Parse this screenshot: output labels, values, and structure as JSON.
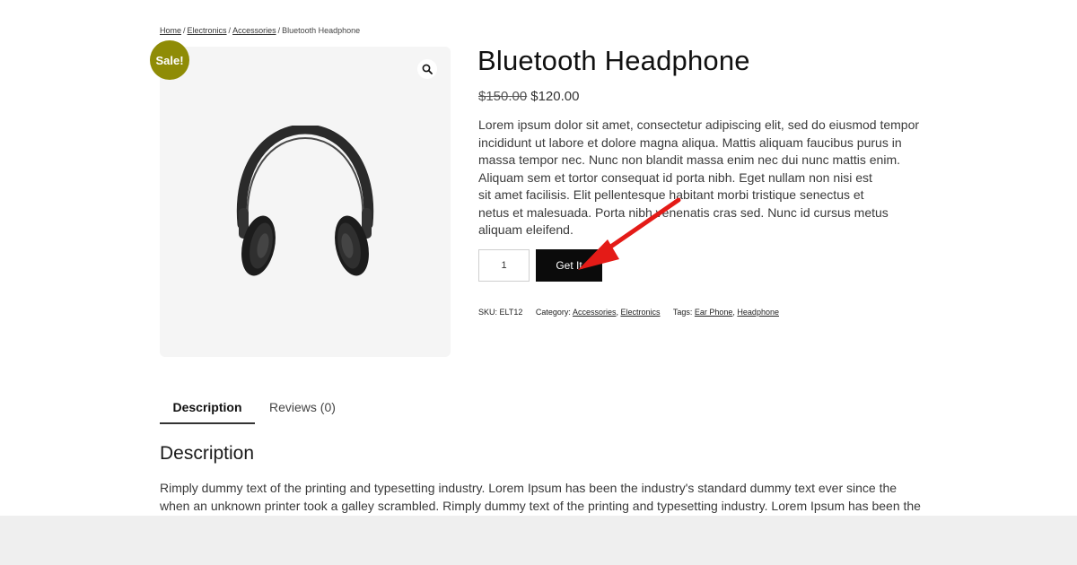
{
  "breadcrumb": {
    "items": [
      "Home",
      "Electronics",
      "Accessories"
    ],
    "separator": "/",
    "current": "Bluetooth Headphone"
  },
  "product": {
    "sale_badge": "Sale!",
    "title": "Bluetooth Headphone",
    "price_old": "$150.00",
    "price_new": "$120.00",
    "short_description_lines": [
      "Lorem ipsum dolor sit amet, consectetur adipiscing elit, sed do eiusmod tempor",
      "incididunt ut labore et dolore magna aliqua. Mattis aliquam faucibus purus in",
      "massa tempor nec. Nunc non blandit massa enim nec dui nunc mattis enim.",
      "Aliquam sem et tortor consequat id porta nibh. Eget nullam non nisi est",
      "sit amet facilisis. Elit pellentesque habitant morbi tristique senectus et",
      "netus et malesuada. Porta nibh venenatis cras sed. Nunc id cursus metus",
      "aliquam eleifend."
    ],
    "quantity": "1",
    "cta_label": "Get It",
    "image_icon": "headphones-image",
    "zoom_icon": "magnifier-icon",
    "colors": {
      "sale_badge": "#8f8c06",
      "cta_background": "#0b0b0b",
      "annotation_arrow": "#e41b17"
    }
  },
  "meta": {
    "sku_label": "SKU:",
    "sku": "ELT12",
    "category_label": "Category:",
    "categories": [
      "Accessories",
      "Electronics"
    ],
    "tags_label": "Tags:",
    "tags": [
      "Ear Phone",
      "Headphone"
    ]
  },
  "tabs": {
    "items": [
      "Description",
      "Reviews (0)"
    ],
    "active": "Description"
  },
  "description": {
    "heading": "Description",
    "lines": [
      "Rimply dummy text of the printing and typesetting industry. Lorem Ipsum has been the industry's standard dummy text ever since the",
      "when an unknown printer took a galley scrambled. Rimply dummy text of the printing and typesetting industry. Lorem Ipsum has been the"
    ]
  }
}
